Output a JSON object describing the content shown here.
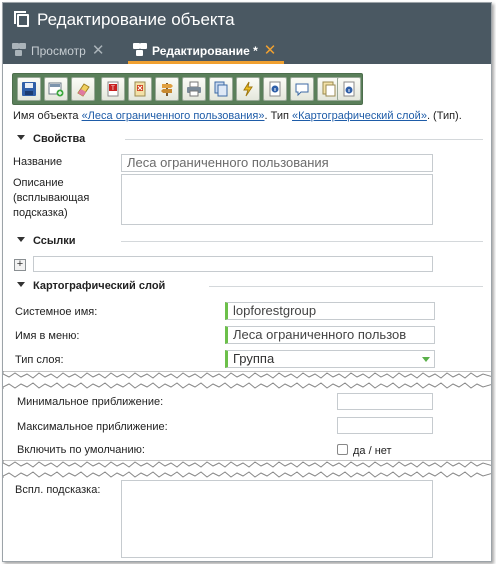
{
  "window": {
    "title": "Редактирование объекта",
    "tabs": [
      {
        "label": "Просмотр",
        "close": "✕"
      },
      {
        "label": "Редактирование *",
        "close": "✕"
      }
    ]
  },
  "toolbar": {
    "buttons": [
      "save-icon",
      "save-add-icon",
      "eraser-icon",
      "text-red-icon",
      "doc-x-icon",
      "signpost-icon",
      "print-icon",
      "copy-icon",
      "tool-lightning-icon",
      "info-doc-icon",
      "comment-icon",
      "doc-copy-icon",
      "doc-info-icon"
    ]
  },
  "object_line": {
    "prefix": "Имя объекта ",
    "object_link": "«Леса ограниченного пользования»",
    "mid": ". Тип ",
    "type_link": "«Картографический слой»",
    "suffix": ". (Тип)."
  },
  "properties": {
    "header": "Свойства",
    "name_label": "Название",
    "name_value": "Леса ограниченного пользования",
    "desc_label_1": "Описание",
    "desc_label_2": "(всплывающая",
    "desc_label_3": "подсказка)",
    "desc_value": ""
  },
  "links": {
    "header": "Ссылки",
    "plus": "+",
    "value": ""
  },
  "map_layer": {
    "header": "Картографический слой",
    "system_name_label": "Системное имя:",
    "system_name_value": "lopforestgroup",
    "menu_name_label": "Имя в меню:",
    "menu_name_value": "Леса ограниченного пользов",
    "layer_type_label": "Тип слоя:",
    "layer_type_value": "Группа",
    "min_zoom_label": "Минимальное приближение:",
    "min_zoom_value": "",
    "max_zoom_label": "Максимальное приближение:",
    "max_zoom_value": "",
    "default_on_label": "Включить по умолчанию:",
    "default_on_text": "да / нет",
    "tooltip_label": "Вспл. подсказка:",
    "tooltip_value": ""
  },
  "colors": {
    "titlebar": "#4a5862",
    "toolbar": "#5a7f5a",
    "link": "#1e5ca8",
    "required_marker": "#6cc04a",
    "active_tab_underline": "#f0a030"
  }
}
